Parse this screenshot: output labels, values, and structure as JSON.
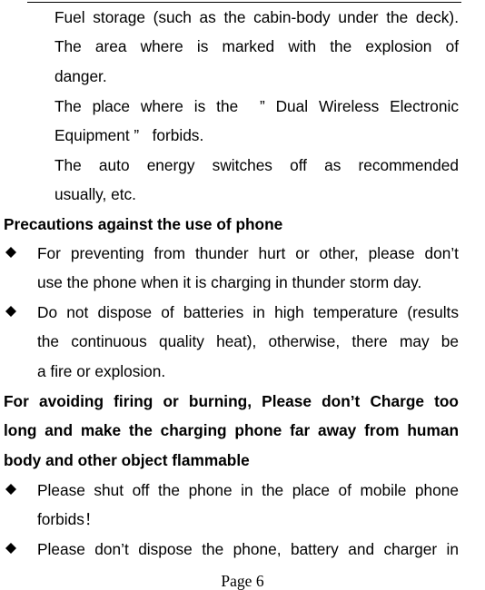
{
  "continued_list": [
    {
      "lines": [
        "Fuel storage (such as the cabin-body under the deck)."
      ]
    },
    {
      "lines": [
        "The area where is marked with the explosion of",
        "danger."
      ]
    },
    {
      "lines": [
        "The place where is the  ” Dual Wireless Electronic",
        "Equipment ”   forbids."
      ]
    },
    {
      "lines": [
        "The auto energy switches off as recommended",
        "usually, etc."
      ]
    }
  ],
  "section1": {
    "heading": "Precautions against the use of phone",
    "bullets": [
      {
        "icon": "diamond-bullet",
        "lines": [
          "For preventing from thunder hurt or other, please don’t",
          "use the phone when it is charging in thunder storm day."
        ]
      },
      {
        "icon": "diamond-bullet",
        "lines": [
          "Do not dispose of batteries in high temperature (results",
          "the continuous quality heat), otherwise, there may be",
          "a fire or explosion."
        ]
      }
    ]
  },
  "section2": {
    "heading_lines": [
      "For avoiding firing or burning, Please don’t Charge too",
      "long and make the charging phone far away from human",
      "body and other object flammable"
    ],
    "bullets": [
      {
        "icon": "diamond-bullet",
        "lines": [
          "Please shut off the phone in the place of mobile phone",
          "forbids！"
        ]
      },
      {
        "icon": "diamond-bullet",
        "lines": [
          "Please don’t dispose the phone, battery and charger in"
        ]
      }
    ]
  },
  "footer": {
    "page_label": "Page 6"
  }
}
